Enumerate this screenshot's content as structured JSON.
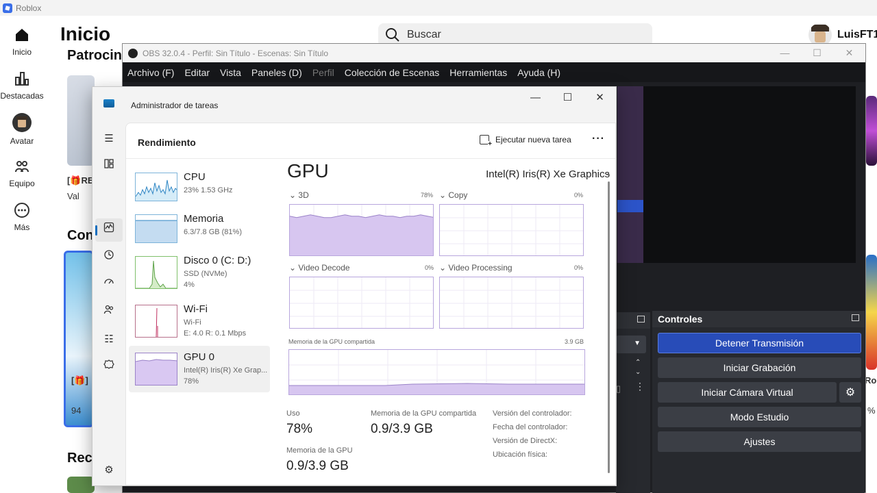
{
  "roblox": {
    "window_title": "Roblox",
    "page_title": "Inicio",
    "search_placeholder": "Buscar",
    "username": "LuisFT1",
    "nav": [
      {
        "label": "Inicio"
      },
      {
        "label": "Destacadas"
      },
      {
        "label": "Avatar"
      },
      {
        "label": "Equipo"
      },
      {
        "label": "Más"
      }
    ],
    "section_sponsored": "Patrocin",
    "section_con": "Con",
    "section_rec": "Rec",
    "card_small_1": "[🎁RE",
    "card_small_2": "Val",
    "card_small_3": "[🎁]",
    "card_small_4": "94",
    "right_edge_text": "Rob",
    "right_edge_pct": "%"
  },
  "obs": {
    "window_title": "OBS 32.0.4 - Perfil: Sin Título - Escenas: Sin Título",
    "menu": [
      {
        "label": "Archivo (F)",
        "disabled": false
      },
      {
        "label": "Editar",
        "disabled": false
      },
      {
        "label": "Vista",
        "disabled": false
      },
      {
        "label": "Paneles (D)",
        "disabled": false
      },
      {
        "label": "Perfil",
        "disabled": true
      },
      {
        "label": "Colección de Escenas",
        "disabled": false
      },
      {
        "label": "Herramientas",
        "disabled": false
      },
      {
        "label": "Ayuda (H)",
        "disabled": false
      }
    ],
    "controls": {
      "title": "Controles",
      "stop_stream": "Detener Transmisión",
      "start_recording": "Iniciar Grabación",
      "start_virtual_cam": "Iniciar Cámara Virtual",
      "studio_mode": "Modo Estudio",
      "settings": "Ajustes"
    }
  },
  "task_manager": {
    "title": "Administrador de tareas",
    "header": "Rendimiento",
    "run_new_task": "Ejecutar nueva tarea",
    "resources": [
      {
        "name": "CPU",
        "sub1": "23%  1.53 GHz",
        "sub2": "",
        "sub3": ""
      },
      {
        "name": "Memoria",
        "sub1": "6.3/7.8 GB (81%)",
        "sub2": "",
        "sub3": ""
      },
      {
        "name": "Disco 0 (C: D:)",
        "sub1": "SSD (NVMe)",
        "sub2": "4%",
        "sub3": ""
      },
      {
        "name": "Wi-Fi",
        "sub1": "Wi-Fi",
        "sub2": "E: 4.0  R: 0.1 Mbps",
        "sub3": ""
      },
      {
        "name": "GPU 0",
        "sub1": "Intel(R) Iris(R) Xe Grap...",
        "sub2": "78%",
        "sub3": ""
      }
    ],
    "gpu": {
      "title": "GPU",
      "model": "Intel(R) Iris(R) Xe Graphics",
      "engines": [
        {
          "label": "3D",
          "pct": "78%",
          "level": 0.78
        },
        {
          "label": "Copy",
          "pct": "0%",
          "level": 0.0
        },
        {
          "label": "Video Decode",
          "pct": "0%",
          "level": 0.0
        },
        {
          "label": "Video Processing",
          "pct": "0%",
          "level": 0.0
        }
      ],
      "shared_memory_label": "Memoria de la GPU compartida",
      "shared_memory_max": "3.9 GB",
      "stats": {
        "usage_label": "Uso",
        "usage_value": "78%",
        "shared_label": "Memoria de la GPU compartida",
        "shared_value": "0.9/3.9 GB",
        "gpu_mem_label": "Memoria de la GPU",
        "gpu_mem_value": "0.9/3.9 GB"
      },
      "info_labels": [
        "Versión del controlador:",
        "Fecha del controlador:",
        "Versión de DirectX:",
        "Ubicación física:"
      ]
    }
  },
  "colors": {
    "accent_purple": "#c9b6ee",
    "accent_purple_line": "#9a82c8",
    "obs_primary": "#284cb8",
    "cpu_line": "#2f86c4",
    "disk_fill": "#7fc06a"
  }
}
